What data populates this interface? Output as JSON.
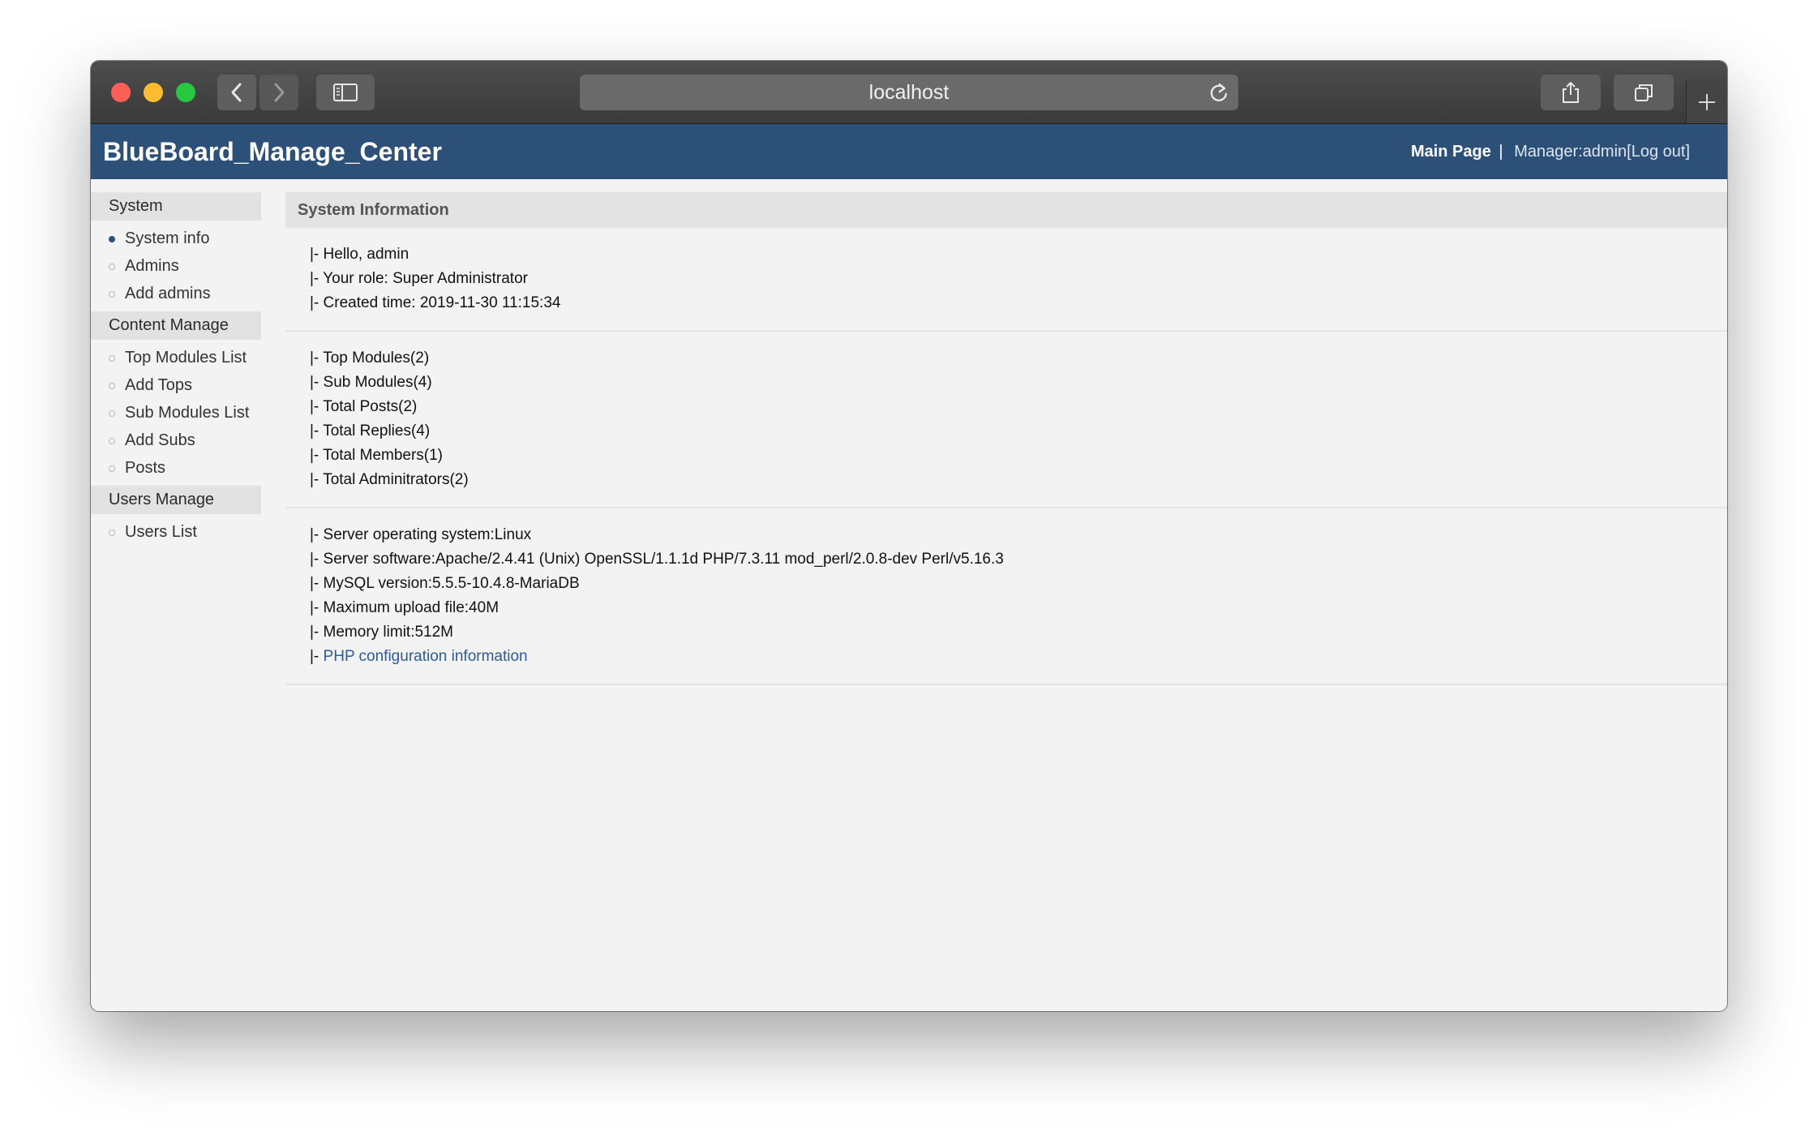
{
  "browser": {
    "address": "localhost"
  },
  "header": {
    "brand": "BlueBoard_Manage_Center",
    "main_page": "Main Page",
    "separator": "|",
    "manager": "Manager:admin[Log out]"
  },
  "sidebar": {
    "sections": [
      {
        "title": "System",
        "items": [
          "System info",
          "Admins",
          "Add admins"
        ]
      },
      {
        "title": "Content Manage",
        "items": [
          "Top Modules List",
          "Add Tops",
          "Sub Modules List",
          "Add Subs",
          "Posts"
        ]
      },
      {
        "title": "Users Manage",
        "items": [
          "Users List"
        ]
      }
    ],
    "active_item": "System info"
  },
  "main": {
    "title": "System Information",
    "user_block": {
      "hello": "|- Hello, admin",
      "role": "|- Your role: Super Administrator",
      "created": "|- Created time: 2019-11-30 11:15:34"
    },
    "stats_block": {
      "top_modules": "|- Top Modules(2)",
      "sub_modules": "|- Sub Modules(4)",
      "total_posts": "|- Total Posts(2)",
      "total_replies": "|- Total Replies(4)",
      "total_members": "|- Total Members(1)",
      "total_admins": "|- Total Adminitrators(2)"
    },
    "server_block": {
      "os": "|- Server operating system:Linux",
      "software": "|- Server software:Apache/2.4.41 (Unix) OpenSSL/1.1.1d PHP/7.3.11 mod_perl/2.0.8-dev Perl/v5.16.3",
      "mysql": "|- MySQL version:5.5.5-10.4.8-MariaDB",
      "upload": "|- Maximum upload file:40M",
      "memory": "|- Memory limit:512M",
      "php_prefix": "|- ",
      "php_link": "PHP configuration information"
    }
  },
  "colors": {
    "header_bg": "#2d5078",
    "link": "#2d5a9a"
  }
}
